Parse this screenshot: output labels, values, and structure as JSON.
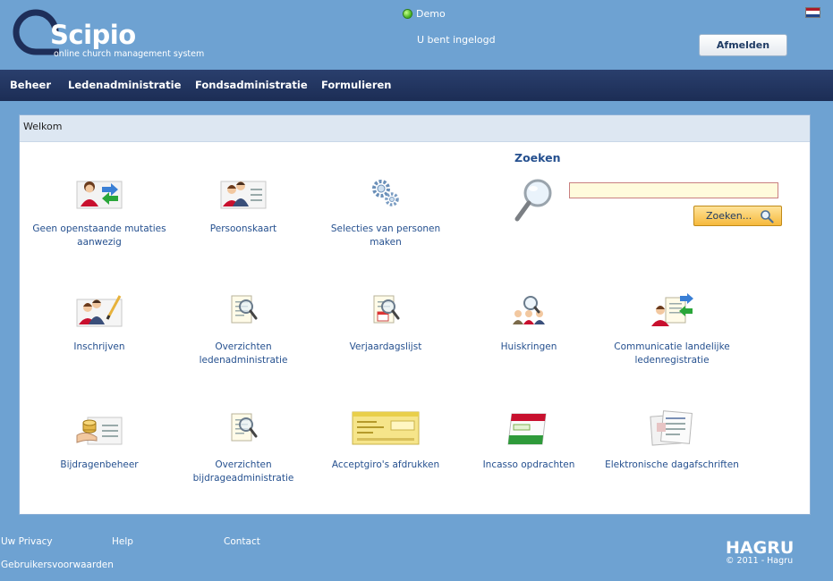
{
  "header": {
    "logo_word": "Scipio",
    "logo_tagline": "online church management system",
    "environment": "Demo",
    "login_status": "U bent ingelogd",
    "logout_label": "Afmelden",
    "flag_colors": [
      "#ae1c28",
      "#ffffff",
      "#21468b"
    ]
  },
  "nav": {
    "items": [
      "Beheer",
      "Ledenadministratie",
      "Fondsadministratie",
      "Formulieren"
    ]
  },
  "panel": {
    "title": "Welkom"
  },
  "tiles": [
    {
      "label": "Geen openstaande mutaties aanwezig",
      "icon": "person-sync-icon"
    },
    {
      "label": "Persoonskaart",
      "icon": "person-card-icon"
    },
    {
      "label": "Selecties van personen maken",
      "icon": "gears-icon"
    },
    {
      "label": "Inschrijven",
      "icon": "person-register-icon"
    },
    {
      "label": "Overzichten ledenadministratie",
      "icon": "document-search-icon"
    },
    {
      "label": "Verjaardagslijst",
      "icon": "birthday-list-icon"
    },
    {
      "label": "Huiskringen",
      "icon": "group-search-icon"
    },
    {
      "label": "Communicatie landelijke ledenregistratie",
      "icon": "person-export-icon"
    },
    {
      "label": "Bijdragenbeheer",
      "icon": "contribution-icon"
    },
    {
      "label": "Overzichten bijdrageadministratie",
      "icon": "document-search-icon"
    },
    {
      "label": "Acceptgiro's afdrukken",
      "icon": "acceptgiro-icon"
    },
    {
      "label": "Incasso opdrachten",
      "icon": "direct-debit-icon"
    },
    {
      "label": "Elektronische dagafschriften",
      "icon": "bank-statement-icon"
    }
  ],
  "search": {
    "title": "Zoeken",
    "value": "",
    "button_label": "Zoeken..."
  },
  "footer": {
    "links": [
      "Uw Privacy",
      "Help",
      "Contact",
      "Gebruikersvoorwaarden"
    ],
    "brand": "HAGRU",
    "copyright": "© 2011 - Hagru"
  },
  "colors": {
    "page_blue": "#6ea2d2",
    "nav_navy": "#1c2d55",
    "link_blue": "#25508f"
  }
}
